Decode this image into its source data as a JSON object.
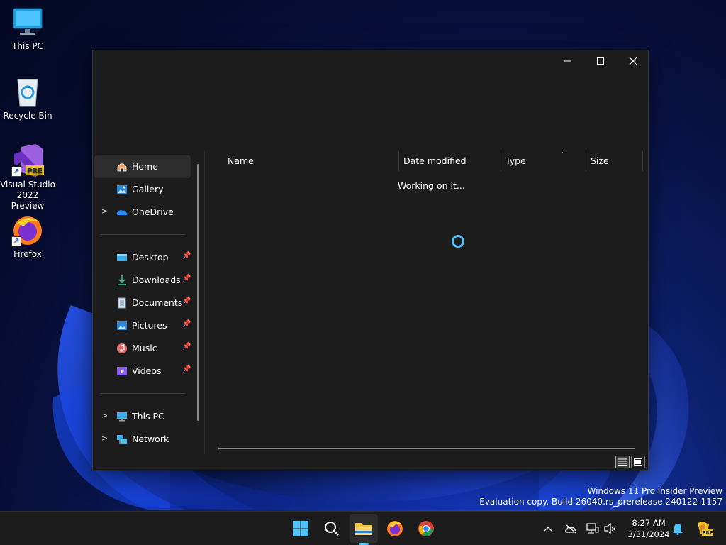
{
  "desktop": {
    "icons": [
      {
        "label": "This PC"
      },
      {
        "label": "Recycle Bin"
      },
      {
        "label": "Visual Studio 2022 Preview",
        "badge": "PRE"
      },
      {
        "label": "Firefox"
      }
    ]
  },
  "explorer": {
    "window_controls": {
      "minimize": "—",
      "maximize": "☐",
      "close": "✕"
    },
    "nav": {
      "home": "Home",
      "gallery": "Gallery",
      "onedrive": "OneDrive",
      "desktop": "Desktop",
      "downloads": "Downloads",
      "documents": "Documents",
      "pictures": "Pictures",
      "music": "Music",
      "videos": "Videos",
      "this_pc": "This PC",
      "network": "Network"
    },
    "columns": {
      "name": "Name",
      "date_modified": "Date modified",
      "type": "Type",
      "size": "Size"
    },
    "status": "Working on it...",
    "accent": "#4cc2ff"
  },
  "watermark": {
    "line1": "Windows 11 Pro Insider Preview",
    "line2": "Evaluation copy. Build 26040.rs_prerelease.240122-1157"
  },
  "taskbar": {
    "clock": {
      "time": "8:27 AM",
      "date": "3/31/2024"
    },
    "tray_badge": "PRE"
  }
}
